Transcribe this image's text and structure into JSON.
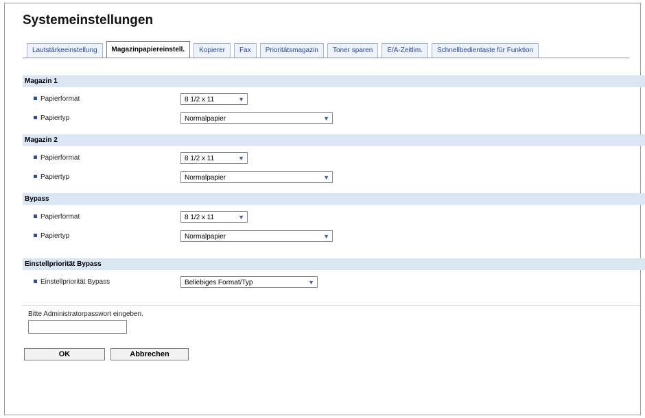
{
  "page": {
    "title": "Systemeinstellungen"
  },
  "tabs": [
    {
      "label": "Lautstärkeeinstellung"
    },
    {
      "label": "Magazinpapiereinstell."
    },
    {
      "label": "Kopierer"
    },
    {
      "label": "Fax"
    },
    {
      "label": "Prioritätsmagazin"
    },
    {
      "label": "Toner sparen"
    },
    {
      "label": "E/A-Zeitlim."
    },
    {
      "label": "Schnellbedientaste für Funktion"
    }
  ],
  "active_tab": "Magazinpapiereinstell.",
  "sections": {
    "magazin1": {
      "title": "Magazin 1",
      "papierformat_label": "Papierformat",
      "papierformat_value": "8 1/2 x 11",
      "papiertyp_label": "Papiertyp",
      "papiertyp_value": "Normalpapier"
    },
    "magazin2": {
      "title": "Magazin 2",
      "papierformat_label": "Papierformat",
      "papierformat_value": "8 1/2 x 11",
      "papiertyp_label": "Papiertyp",
      "papiertyp_value": "Normalpapier"
    },
    "bypass": {
      "title": "Bypass",
      "papierformat_label": "Papierformat",
      "papierformat_value": "8 1/2 x 11",
      "papiertyp_label": "Papiertyp",
      "papiertyp_value": "Normalpapier"
    },
    "prioritaet": {
      "title": "Einstellpriorität Bypass",
      "label": "Einstellpriorität Bypass",
      "value": "Beliebiges Format/Typ"
    }
  },
  "password": {
    "hint": "Bitte Administratorpasswort eingeben."
  },
  "buttons": {
    "ok": "OK",
    "cancel": "Abbrechen"
  },
  "icons": {
    "dropdown": "chevron-down-icon",
    "bullet": "square-bullet-icon"
  },
  "colors": {
    "tab_text": "#24469a",
    "section_bg": "#dbe6f4",
    "bullet": "#2e4f9c"
  }
}
